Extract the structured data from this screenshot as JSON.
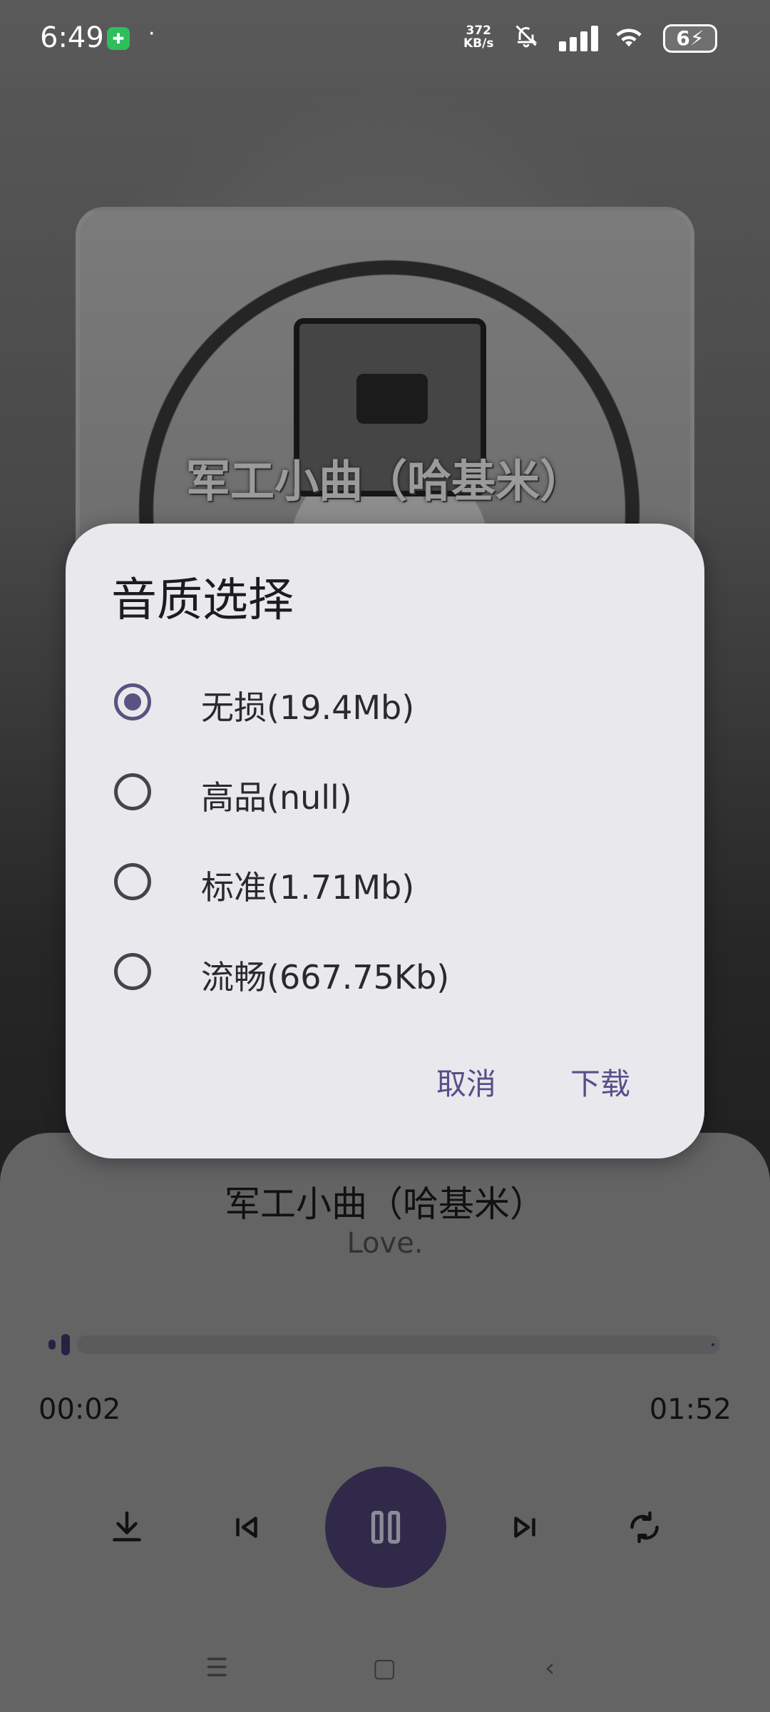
{
  "status_bar": {
    "time": "6:49",
    "speed_value": "372",
    "speed_unit": "KB/s",
    "battery": "6"
  },
  "album": {
    "caption": "军工小曲（哈基米）"
  },
  "player": {
    "title": "军工小曲（哈基米）",
    "artist": "Love.",
    "current_time": "00:02",
    "total_time": "01:52",
    "progress_fraction": 0.018,
    "controls": [
      "download-icon",
      "previous-icon",
      "pause-icon",
      "next-icon",
      "repeat-icon"
    ]
  },
  "dialog": {
    "title": "音质选择",
    "options": [
      {
        "label": "无损(19.4Mb)",
        "checked": true
      },
      {
        "label": "高品(null)",
        "checked": false
      },
      {
        "label": "标准(1.71Mb)",
        "checked": false
      },
      {
        "label": "流畅(667.75Kb)",
        "checked": false
      }
    ],
    "cancel_label": "取消",
    "confirm_label": "下载"
  },
  "colors": {
    "accent": "#574f8a",
    "play_button": "#4a4070",
    "dialog_bg": "#e9e8ed"
  }
}
